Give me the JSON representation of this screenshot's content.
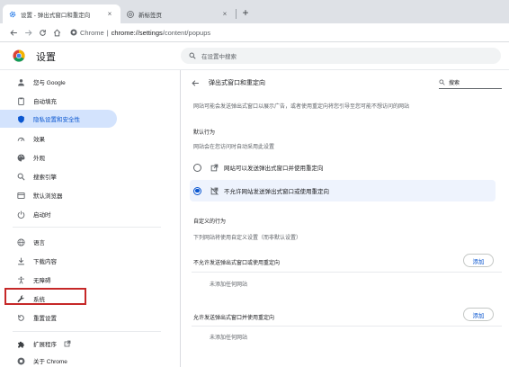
{
  "tabs": [
    {
      "title": "设置 - 弹出式窗口和重定向",
      "close": "×",
      "icon": "gear-icon"
    },
    {
      "title": "新标签页",
      "close": "×",
      "icon": "chrome-logo-icon"
    }
  ],
  "new_tab_symbol": "+",
  "omnibox": {
    "scheme": "Chrome",
    "divider": "|",
    "host": "chrome://settings",
    "path": "/content/popups"
  },
  "header": {
    "title": "设置",
    "search_placeholder": "在设置中搜索"
  },
  "sidebar": {
    "items": [
      {
        "label": "您与 Google",
        "icon": "person-icon"
      },
      {
        "label": "自动填充",
        "icon": "clipboard-icon"
      },
      {
        "label": "隐私设置和安全性",
        "icon": "shield-icon"
      },
      {
        "label": "效果",
        "icon": "speedometer-icon"
      },
      {
        "label": "外观",
        "icon": "palette-icon"
      },
      {
        "label": "搜索引擎",
        "icon": "search-icon"
      },
      {
        "label": "默认浏览器",
        "icon": "browser-window-icon"
      },
      {
        "label": "启动时",
        "icon": "power-icon"
      },
      {
        "label": "语言",
        "icon": "globe-icon"
      },
      {
        "label": "下载内容",
        "icon": "download-icon"
      },
      {
        "label": "无障碍",
        "icon": "accessibility-icon"
      },
      {
        "label": "系统",
        "icon": "wrench-icon"
      },
      {
        "label": "重置设置",
        "icon": "reset-icon"
      },
      {
        "label": "扩展程序",
        "icon": "puzzle-icon"
      },
      {
        "label": "关于 Chrome",
        "icon": "chrome-logo-icon"
      }
    ],
    "selected_index": 2,
    "highlighted_index": 11
  },
  "popups": {
    "title": "弹出式窗口和重定向",
    "search_placeholder": "搜索",
    "description": "网站可能会发送弹出式窗口以展示广告，或者使用重定向将您引导至您可能不想访问的网站",
    "default_behavior_heading": "默认行为",
    "default_behavior_sub": "网站会在您访问时自动采用此设置",
    "options": [
      {
        "label": "网站可以发送弹出式窗口并使用重定向",
        "checked": false,
        "icon": "open-in-new-icon"
      },
      {
        "label": "不允许网站发送弹出式窗口或使用重定向",
        "checked": true,
        "icon": "blocked-popup-icon"
      }
    ],
    "custom_heading": "自定义的行为",
    "custom_sub": "下列网站将使用自定义设置（而非默认设置）",
    "blocked_heading": "不允许发送弹出式窗口或使用重定向",
    "blocked_add": "添加",
    "blocked_empty": "未添加任何网站",
    "allowed_heading": "允许发送弹出式窗口并使用重定向",
    "allowed_add": "添加",
    "allowed_empty": "未添加任何网站"
  },
  "colors": {
    "accent": "#0b57d0",
    "selected_bg": "#d3e3fd",
    "highlight_box": "#c62828",
    "tabstrip_bg": "#dee1e6"
  }
}
